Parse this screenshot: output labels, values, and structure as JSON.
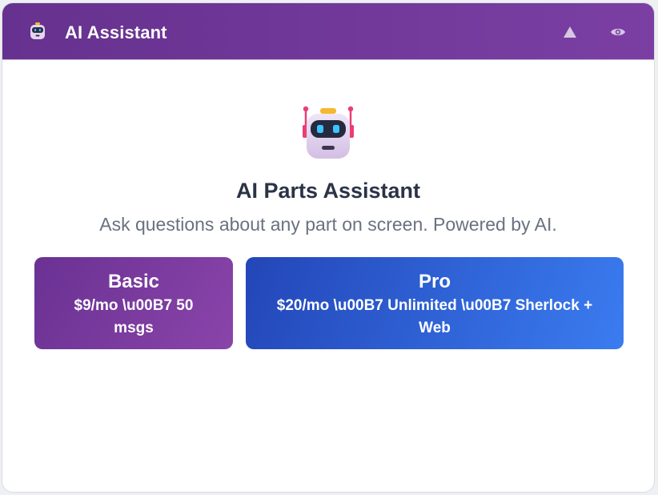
{
  "header": {
    "title": "AI Assistant",
    "icons": {
      "logo": "robot-icon",
      "collapse": "triangle-up-icon",
      "view": "eye-icon"
    }
  },
  "hero": {
    "icon": "robot-icon",
    "title": "AI Parts Assistant",
    "subtitle": "Ask questions about any part on screen. Powered by AI."
  },
  "plans": [
    {
      "name": "Basic",
      "description": "$9/mo \\u00B7 50 msgs"
    },
    {
      "name": "Pro",
      "description": "$20/mo \\u00B7 Unlimited \\u00B7 Sherlock + Web"
    }
  ],
  "colors": {
    "header_gradient_start": "#66318f",
    "header_gradient_end": "#7b3fa3",
    "basic_gradient_start": "#6a3193",
    "basic_gradient_end": "#8a44aa",
    "pro_gradient_start": "#2346b8",
    "pro_gradient_end": "#3a7cf0",
    "title_text": "#2b3346",
    "subtitle_text": "#6a7180"
  }
}
